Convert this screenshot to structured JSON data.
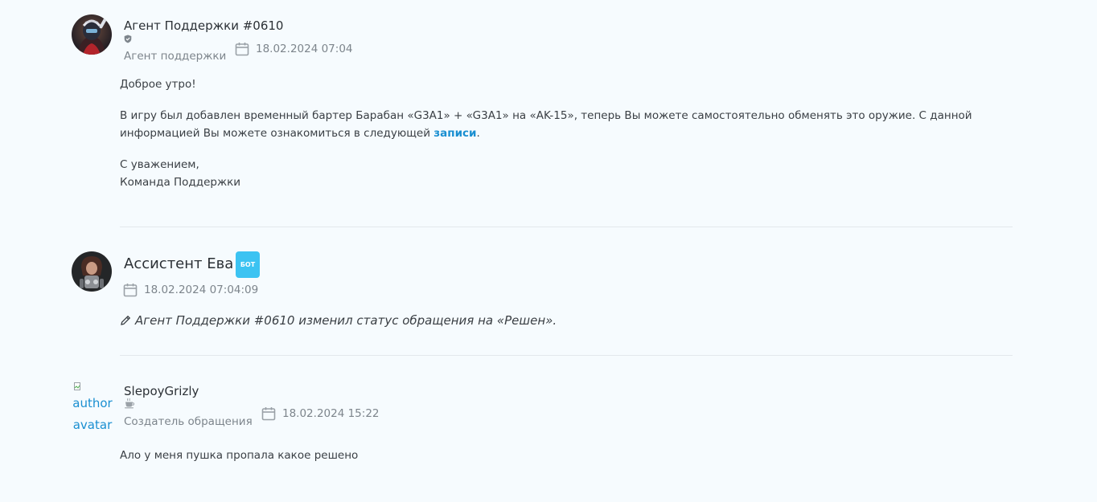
{
  "messages": [
    {
      "author": "Агент Поддержки #0610",
      "role": "Агент поддержки",
      "date": "18.02.2024 07:04",
      "body": {
        "greeting": "Доброе утро!",
        "text_before_link": "В игру был добавлен временный бартер Барабан «G3A1» + «G3A1» на «AK-15», теперь Вы можете самостоятельно обменять это оружие. С данной информацией Вы можете ознакомиться в следующей",
        "link_text": "записи",
        "text_after_link": ".",
        "sign_line1": "С уважением,",
        "sign_line2": "Команда Поддержки"
      }
    },
    {
      "author": "Ассистент Ева",
      "badge": "БОТ",
      "date": "18.02.2024 07:04:09",
      "status_text": "Агент Поддержки #0610 изменил статус обращения на «Решен»."
    },
    {
      "author": "SlepoyGrizly",
      "avatar_alt": "author avatar",
      "role": "Создатель обращения",
      "date": "18.02.2024 15:22",
      "body": "Ало у меня пушка пропала какое решено"
    }
  ],
  "icons": {
    "agent_role": "shield-icon",
    "creator_role": "coffee-cup-icon",
    "date": "calendar-icon",
    "status_change": "pencil-icon"
  },
  "colors": {
    "background": "#f6fbfe",
    "link": "#1a8fd1",
    "bot_badge": "#3cc3f2",
    "muted_text": "#7d858c",
    "divider": "#e3e8ec"
  }
}
